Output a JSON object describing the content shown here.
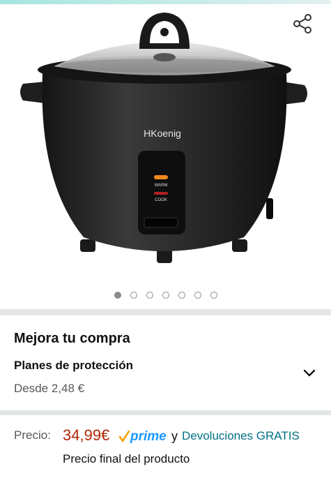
{
  "carousel": {
    "brand_label": "HKoenig",
    "warm_label": "WARM",
    "cook_label": "COOK",
    "page_count": 7,
    "active_index": 0
  },
  "upgrade": {
    "title": "Mejora tu compra",
    "plan_title": "Planes de protección",
    "plan_price": "Desde 2,48 €"
  },
  "price": {
    "label": "Precio:",
    "value": "34,99€",
    "prime": "prime",
    "and": "y",
    "returns": "Devoluciones GRATIS",
    "final_note": "Precio final del producto"
  },
  "colors": {
    "price": "#b12704",
    "link": "#007185",
    "prime_check": "#f7a300",
    "prime_text": "#1a98ff"
  }
}
